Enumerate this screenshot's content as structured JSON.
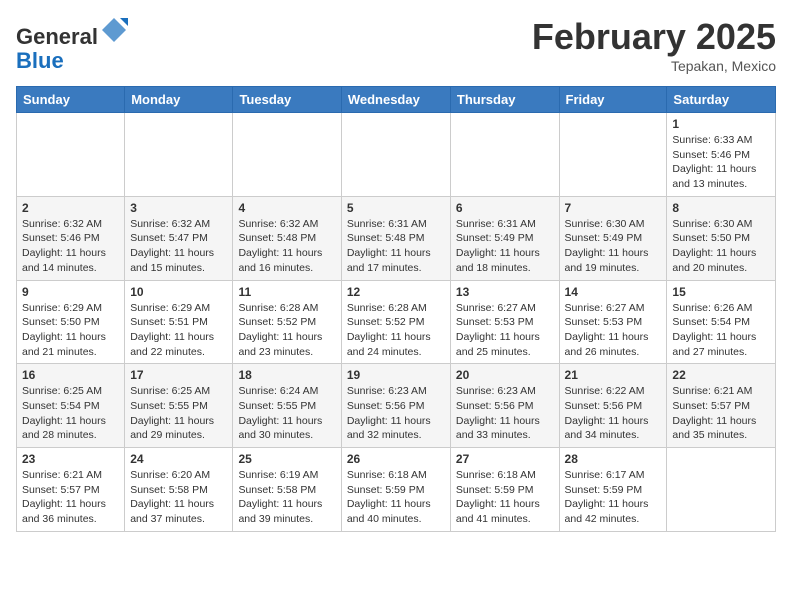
{
  "header": {
    "logo_line1": "General",
    "logo_line2": "Blue",
    "month_title": "February 2025",
    "location": "Tepakan, Mexico"
  },
  "weekdays": [
    "Sunday",
    "Monday",
    "Tuesday",
    "Wednesday",
    "Thursday",
    "Friday",
    "Saturday"
  ],
  "weeks": [
    [
      {
        "day": "",
        "info": ""
      },
      {
        "day": "",
        "info": ""
      },
      {
        "day": "",
        "info": ""
      },
      {
        "day": "",
        "info": ""
      },
      {
        "day": "",
        "info": ""
      },
      {
        "day": "",
        "info": ""
      },
      {
        "day": "1",
        "info": "Sunrise: 6:33 AM\nSunset: 5:46 PM\nDaylight: 11 hours\nand 13 minutes."
      }
    ],
    [
      {
        "day": "2",
        "info": "Sunrise: 6:32 AM\nSunset: 5:46 PM\nDaylight: 11 hours\nand 14 minutes."
      },
      {
        "day": "3",
        "info": "Sunrise: 6:32 AM\nSunset: 5:47 PM\nDaylight: 11 hours\nand 15 minutes."
      },
      {
        "day": "4",
        "info": "Sunrise: 6:32 AM\nSunset: 5:48 PM\nDaylight: 11 hours\nand 16 minutes."
      },
      {
        "day": "5",
        "info": "Sunrise: 6:31 AM\nSunset: 5:48 PM\nDaylight: 11 hours\nand 17 minutes."
      },
      {
        "day": "6",
        "info": "Sunrise: 6:31 AM\nSunset: 5:49 PM\nDaylight: 11 hours\nand 18 minutes."
      },
      {
        "day": "7",
        "info": "Sunrise: 6:30 AM\nSunset: 5:49 PM\nDaylight: 11 hours\nand 19 minutes."
      },
      {
        "day": "8",
        "info": "Sunrise: 6:30 AM\nSunset: 5:50 PM\nDaylight: 11 hours\nand 20 minutes."
      }
    ],
    [
      {
        "day": "9",
        "info": "Sunrise: 6:29 AM\nSunset: 5:50 PM\nDaylight: 11 hours\nand 21 minutes."
      },
      {
        "day": "10",
        "info": "Sunrise: 6:29 AM\nSunset: 5:51 PM\nDaylight: 11 hours\nand 22 minutes."
      },
      {
        "day": "11",
        "info": "Sunrise: 6:28 AM\nSunset: 5:52 PM\nDaylight: 11 hours\nand 23 minutes."
      },
      {
        "day": "12",
        "info": "Sunrise: 6:28 AM\nSunset: 5:52 PM\nDaylight: 11 hours\nand 24 minutes."
      },
      {
        "day": "13",
        "info": "Sunrise: 6:27 AM\nSunset: 5:53 PM\nDaylight: 11 hours\nand 25 minutes."
      },
      {
        "day": "14",
        "info": "Sunrise: 6:27 AM\nSunset: 5:53 PM\nDaylight: 11 hours\nand 26 minutes."
      },
      {
        "day": "15",
        "info": "Sunrise: 6:26 AM\nSunset: 5:54 PM\nDaylight: 11 hours\nand 27 minutes."
      }
    ],
    [
      {
        "day": "16",
        "info": "Sunrise: 6:25 AM\nSunset: 5:54 PM\nDaylight: 11 hours\nand 28 minutes."
      },
      {
        "day": "17",
        "info": "Sunrise: 6:25 AM\nSunset: 5:55 PM\nDaylight: 11 hours\nand 29 minutes."
      },
      {
        "day": "18",
        "info": "Sunrise: 6:24 AM\nSunset: 5:55 PM\nDaylight: 11 hours\nand 30 minutes."
      },
      {
        "day": "19",
        "info": "Sunrise: 6:23 AM\nSunset: 5:56 PM\nDaylight: 11 hours\nand 32 minutes."
      },
      {
        "day": "20",
        "info": "Sunrise: 6:23 AM\nSunset: 5:56 PM\nDaylight: 11 hours\nand 33 minutes."
      },
      {
        "day": "21",
        "info": "Sunrise: 6:22 AM\nSunset: 5:56 PM\nDaylight: 11 hours\nand 34 minutes."
      },
      {
        "day": "22",
        "info": "Sunrise: 6:21 AM\nSunset: 5:57 PM\nDaylight: 11 hours\nand 35 minutes."
      }
    ],
    [
      {
        "day": "23",
        "info": "Sunrise: 6:21 AM\nSunset: 5:57 PM\nDaylight: 11 hours\nand 36 minutes."
      },
      {
        "day": "24",
        "info": "Sunrise: 6:20 AM\nSunset: 5:58 PM\nDaylight: 11 hours\nand 37 minutes."
      },
      {
        "day": "25",
        "info": "Sunrise: 6:19 AM\nSunset: 5:58 PM\nDaylight: 11 hours\nand 39 minutes."
      },
      {
        "day": "26",
        "info": "Sunrise: 6:18 AM\nSunset: 5:59 PM\nDaylight: 11 hours\nand 40 minutes."
      },
      {
        "day": "27",
        "info": "Sunrise: 6:18 AM\nSunset: 5:59 PM\nDaylight: 11 hours\nand 41 minutes."
      },
      {
        "day": "28",
        "info": "Sunrise: 6:17 AM\nSunset: 5:59 PM\nDaylight: 11 hours\nand 42 minutes."
      },
      {
        "day": "",
        "info": ""
      }
    ]
  ]
}
